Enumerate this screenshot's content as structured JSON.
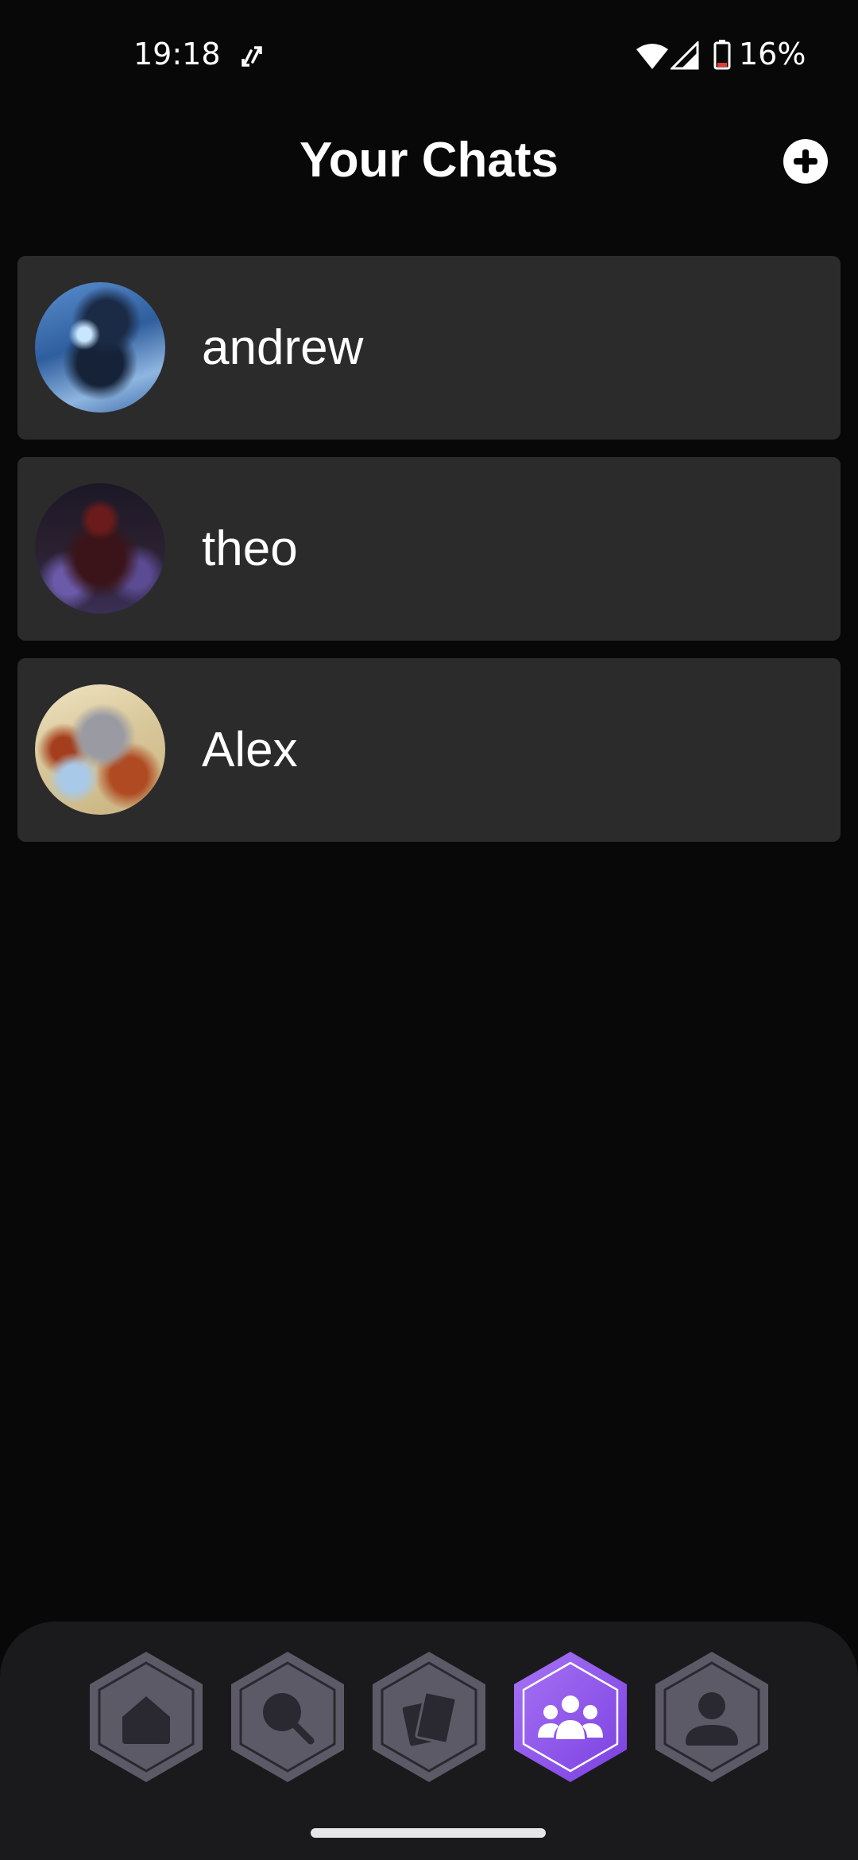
{
  "status_bar": {
    "time": "19:18",
    "battery": "16%",
    "icons": [
      "sync-icon",
      "wifi-icon",
      "signal-icon",
      "battery-icon"
    ]
  },
  "header": {
    "title": "Your Chats",
    "add_icon": "plus-circle-icon"
  },
  "chats": [
    {
      "name": "andrew"
    },
    {
      "name": "theo"
    },
    {
      "name": "Alex"
    }
  ],
  "bottom_nav": {
    "active_index": 3,
    "items": [
      {
        "icon": "home-icon"
      },
      {
        "icon": "search-icon"
      },
      {
        "icon": "cards-icon"
      },
      {
        "icon": "group-icon"
      },
      {
        "icon": "profile-icon"
      }
    ]
  },
  "colors": {
    "background": "#080808",
    "row": "#2b2b2c",
    "nav_bg": "#1a1a1c",
    "nav_inactive": "#5d5a67",
    "nav_active": "#8a52e6"
  }
}
